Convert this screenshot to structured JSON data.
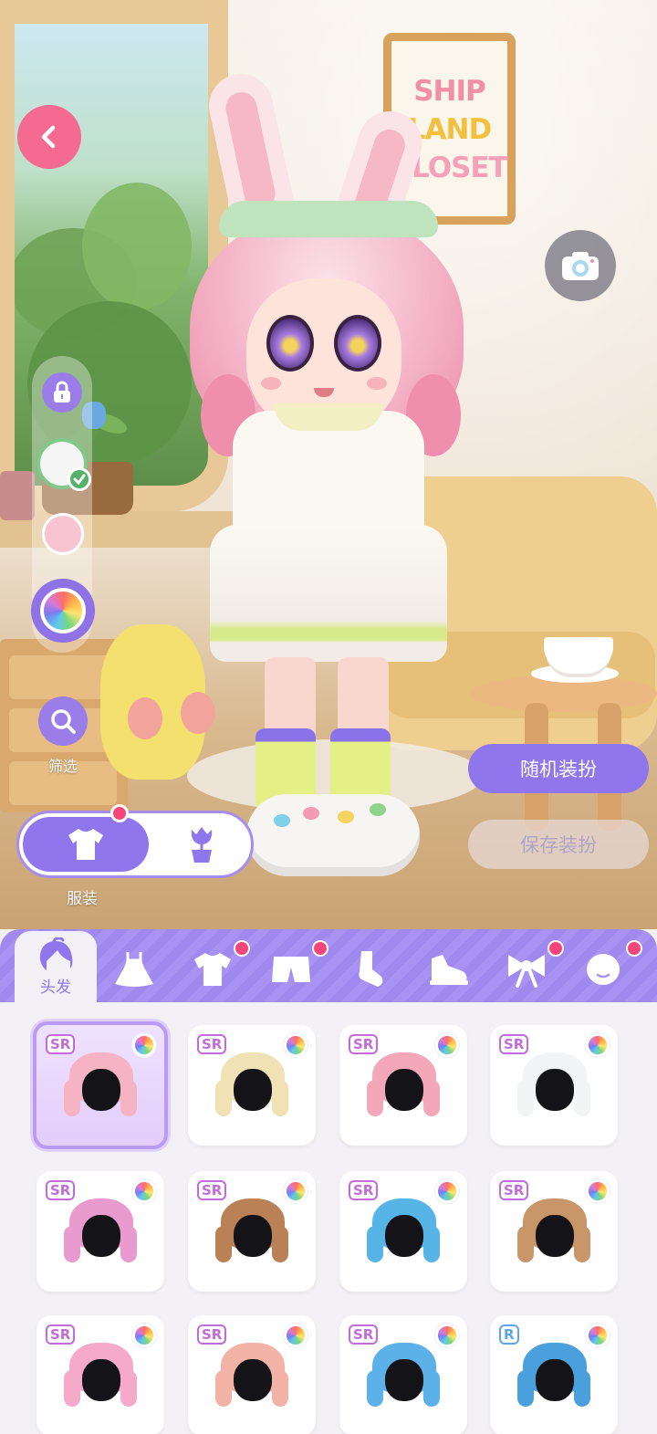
{
  "poster": {
    "line1": "SHIP",
    "line2": "LAND",
    "line3": "CLOSET"
  },
  "controls": {
    "back_icon": "chevron-left-icon",
    "camera_icon": "camera-icon",
    "lock_icon": "lock-icon",
    "palette_icon": "color-wheel-icon",
    "filter_label": "筛选",
    "filter_icon": "search-icon"
  },
  "mode": {
    "active_label": "服装",
    "active_icon": "shirt-icon",
    "inactive_icon": "flower-pot-icon"
  },
  "actions": {
    "random_label": "随机装扮",
    "save_label": "保存装扮"
  },
  "tabs": [
    {
      "icon": "hair-icon",
      "label": "头发",
      "active": true,
      "badge": false
    },
    {
      "icon": "dress-icon",
      "badge": false
    },
    {
      "icon": "shirt-icon",
      "badge": true
    },
    {
      "icon": "shorts-icon",
      "badge": true
    },
    {
      "icon": "sock-icon",
      "badge": false
    },
    {
      "icon": "shoe-icon",
      "badge": false
    },
    {
      "icon": "bow-icon",
      "badge": true
    },
    {
      "icon": "face-icon",
      "badge": true
    }
  ],
  "items": [
    {
      "rarity": "SR",
      "hair": "#f6b3c4",
      "extra": "bunny-ears",
      "selected": true
    },
    {
      "rarity": "SR",
      "hair": "#f1e2b6",
      "extra": "brown-bunny-ears",
      "selected": false
    },
    {
      "rarity": "SR",
      "hair": "#f3a7b8",
      "extra": "twin-tails",
      "selected": false
    },
    {
      "rarity": "SR",
      "hair": "#f2f4f6",
      "extra": "blue-cap",
      "selected": false
    },
    {
      "rarity": "SR",
      "hair": "#e99bd0",
      "extra": "spiky",
      "selected": false
    },
    {
      "rarity": "SR",
      "hair": "#b98155",
      "extra": "messy",
      "selected": false
    },
    {
      "rarity": "SR",
      "hair": "#56b4e6",
      "extra": "buns",
      "selected": false
    },
    {
      "rarity": "SR",
      "hair": "#c9966a",
      "extra": "ahoge",
      "selected": false
    },
    {
      "rarity": "SR",
      "hair": "#f4aac8",
      "extra": "pigtails",
      "selected": false
    },
    {
      "rarity": "SR",
      "hair": "#f2b3a6",
      "extra": "wavy-long",
      "selected": false
    },
    {
      "rarity": "SR",
      "hair": "#5bb1e8",
      "extra": "long-straight",
      "selected": false
    },
    {
      "rarity": "R",
      "hair": "#4aa0dc",
      "extra": "short-bob",
      "selected": false
    }
  ]
}
